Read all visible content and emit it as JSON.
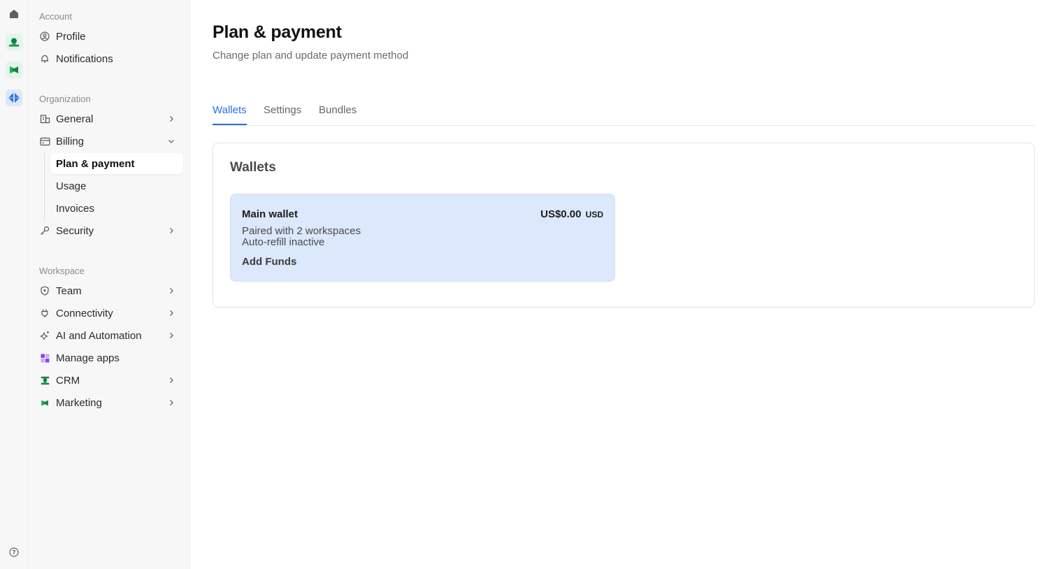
{
  "colors": {
    "accent": "#2a6ee6",
    "crm_green": "#1fae57",
    "marketing_green": "#1fae57",
    "workspace_blue": "#2f6fe0",
    "wallet_bg": "#dce8fb",
    "apps_purple": "#8b3dff"
  },
  "rail": {
    "icons": [
      "home-icon",
      "crm-app-icon",
      "marketing-app-icon",
      "workspace-icon",
      "help-icon"
    ]
  },
  "sidebar": {
    "account_label": "Account",
    "profile": "Profile",
    "notifications": "Notifications",
    "organization_label": "Organization",
    "general": "General",
    "billing": "Billing",
    "billing_sub": [
      "Plan & payment",
      "Usage",
      "Invoices"
    ],
    "security": "Security",
    "workspace_label": "Workspace",
    "team": "Team",
    "connectivity": "Connectivity",
    "ai_automation": "AI and Automation",
    "manage_apps": "Manage apps",
    "crm": "CRM",
    "marketing": "Marketing"
  },
  "main": {
    "title": "Plan & payment",
    "subtitle": "Change plan and update payment method",
    "tabs": [
      {
        "label": "Wallets",
        "active": true
      },
      {
        "label": "Settings",
        "active": false
      },
      {
        "label": "Bundles",
        "active": false
      }
    ],
    "card": {
      "title": "Wallets",
      "wallet": {
        "name": "Main wallet",
        "amount": "US$0.00",
        "currency": "USD",
        "paired": "Paired with 2 workspaces",
        "autorefill": "Auto-refill inactive",
        "action": "Add Funds"
      }
    }
  }
}
